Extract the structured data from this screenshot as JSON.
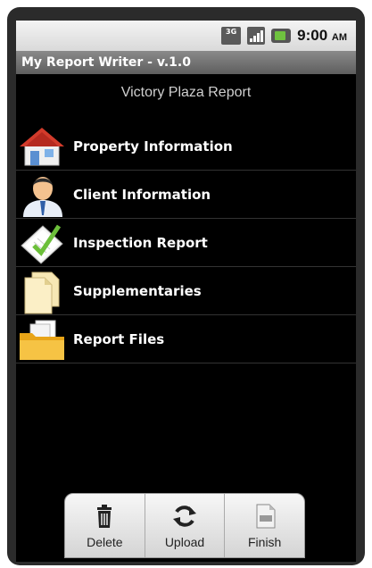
{
  "status_bar": {
    "network_label": "3G",
    "time": "9:00",
    "ampm": "AM"
  },
  "app": {
    "title": "My Report Writer - v.1.0"
  },
  "report": {
    "name": "Victory Plaza Report"
  },
  "menu": [
    {
      "label": "Property Information",
      "icon": "house-icon"
    },
    {
      "label": "Client Information",
      "icon": "person-icon"
    },
    {
      "label": "Inspection Report",
      "icon": "checked-document-icon"
    },
    {
      "label": "Supplementaries",
      "icon": "documents-icon"
    },
    {
      "label": "Report Files",
      "icon": "folder-icon"
    }
  ],
  "actions": [
    {
      "label": "Delete",
      "icon": "trash-icon"
    },
    {
      "label": "Upload",
      "icon": "refresh-icon"
    },
    {
      "label": "Finish",
      "icon": "pdf-document-icon"
    }
  ],
  "colors": {
    "background": "#000000",
    "titlebar": "#6e6e6e",
    "status_bar": "#e6e6e6",
    "folder": "#f2b51f",
    "house_roof": "#d23b2b",
    "check": "#6cbf3a"
  }
}
